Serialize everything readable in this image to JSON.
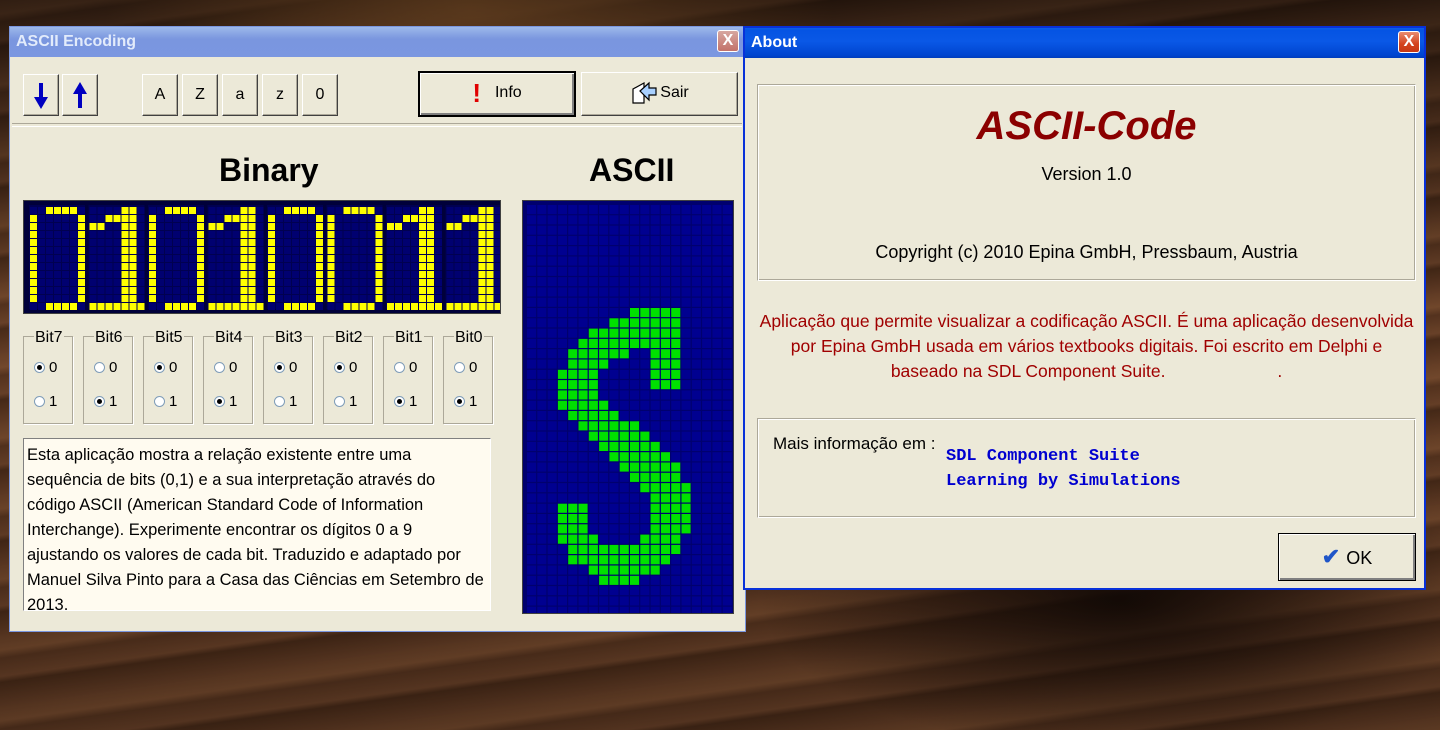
{
  "main_window": {
    "title": "ASCII Encoding",
    "close": "X",
    "toolbar": {
      "down_icon": "arrow-down-icon",
      "up_icon": "arrow-up-icon",
      "char_buttons": [
        "A",
        "Z",
        "a",
        "z",
        "0"
      ],
      "info_label": "Info",
      "info_icon": "exclamation-icon",
      "exit_label": "Sair",
      "exit_icon": "exit-door-icon"
    },
    "binary_heading": "Binary",
    "ascii_heading": "ASCII",
    "binary_digits": [
      "0",
      "1",
      "0",
      "1",
      "0",
      "0",
      "1",
      "1"
    ],
    "bits": [
      {
        "label": "Bit7",
        "value": 0
      },
      {
        "label": "Bit6",
        "value": 1
      },
      {
        "label": "Bit5",
        "value": 0
      },
      {
        "label": "Bit4",
        "value": 1
      },
      {
        "label": "Bit3",
        "value": 0
      },
      {
        "label": "Bit2",
        "value": 0
      },
      {
        "label": "Bit1",
        "value": 1
      },
      {
        "label": "Bit0",
        "value": 1
      }
    ],
    "radio_labels": [
      "0",
      "1"
    ],
    "description": "Esta aplicação mostra a relação existente entre uma sequência de bits (0,1) e a sua interpretação através do código ASCII  (American Standard Code of Information Interchange). Experimente encontrar os dígitos 0 a 9 ajustando os valores de cada bit.  Traduzido e adaptado por Manuel Silva Pinto para a Casa das Ciências em Setembro de 2013.",
    "ascii_character": "S",
    "colors": {
      "led_on": "#ffff00",
      "led_bg": "#00003a",
      "ascii_on": "#00e000",
      "ascii_bg": "#00006e"
    }
  },
  "about_dialog": {
    "title": "About",
    "close": "X",
    "app_name": "ASCII-Code",
    "version": "Version 1.0",
    "copyright": "Copyright (c) 2010 Epina GmbH, Pressbaum, Austria",
    "description": "Aplicação que permite visualizar a codificação ASCII. É uma aplicação desenvolvida por Epina GmbH usada em vários textbooks digitais. Foi escrito em Delphi e baseado na SDL Component Suite.                       .",
    "more_info_label": "Mais informação em :",
    "links": [
      "SDL Component Suite",
      "Learning by Simulations"
    ],
    "ok_label": "OK",
    "colors": {
      "title_red": "#8b0000",
      "desc_red": "#a00000",
      "link_blue": "#0000d0"
    }
  }
}
